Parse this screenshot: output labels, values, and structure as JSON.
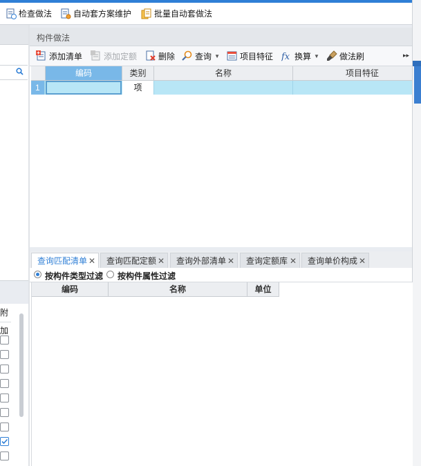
{
  "toolbar": {
    "check_method": "检查做法",
    "auto_scheme": "自动套方案维护",
    "batch_auto": "批量自动套做法"
  },
  "left_panel": {
    "column_label": "附加",
    "checkbox_states": [
      false,
      false,
      false,
      false,
      false,
      false,
      false,
      true,
      false
    ]
  },
  "component_panel": {
    "title": "构件做法",
    "tools": {
      "add_list": "添加清单",
      "add_quota": "添加定额",
      "delete": "删除",
      "query": "查询",
      "item_feature": "项目特征",
      "convert": "换算",
      "method_brush": "做法刷"
    },
    "grid": {
      "headers": [
        "编码",
        "类别",
        "名称",
        "项目特征"
      ],
      "rows": [
        {
          "row_no": "1",
          "code": "",
          "category": "项",
          "name": "",
          "feature": ""
        }
      ]
    }
  },
  "query_tabs": {
    "tabs": [
      "查询匹配清单",
      "查询匹配定额",
      "查询外部清单",
      "查询定额库",
      "查询单价构成"
    ],
    "active_index": 0,
    "filters": [
      "按构件类型过滤",
      "按构件属性过滤"
    ],
    "selected_filter": 0,
    "result_headers": [
      "编码",
      "名称",
      "单位"
    ]
  }
}
